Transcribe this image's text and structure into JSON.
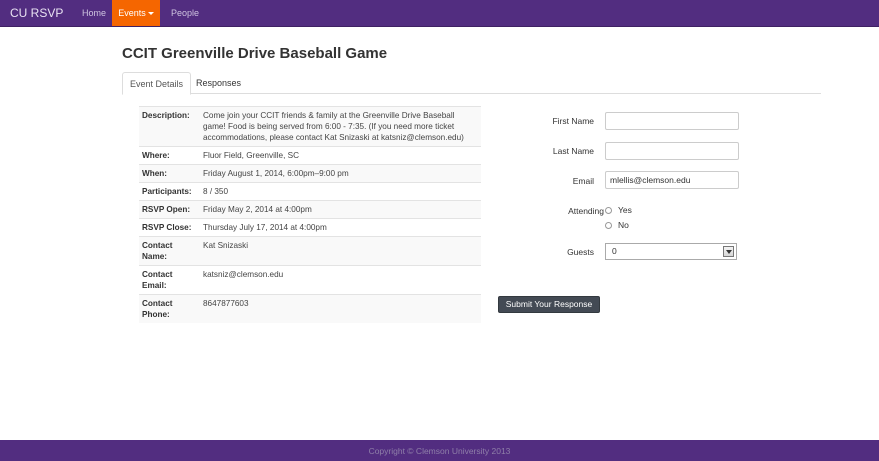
{
  "navbar": {
    "brand": "CU RSVP",
    "items": [
      {
        "label": "Home"
      },
      {
        "label": "Events"
      },
      {
        "label": "People"
      }
    ]
  },
  "page": {
    "title": "CCIT Greenville Drive Baseball Game"
  },
  "tabs": [
    {
      "label": "Event Details",
      "active": true
    },
    {
      "label": "Responses",
      "active": false
    }
  ],
  "details": [
    {
      "key": "Description:",
      "value": "Come join your CCIT friends & family at the Greenville Drive Baseball game! Food is being served from 6:00 - 7:35. (If you need more ticket accommodations, please contact Kat Snizaski at katsniz@clemson.edu)"
    },
    {
      "key": "Where:",
      "value": "Fluor Field, Greenville, SC"
    },
    {
      "key": "When:",
      "value": "Friday August 1, 2014, 6:00pm–9:00 pm"
    },
    {
      "key": "Participants:",
      "value": "8 / 350"
    },
    {
      "key": "RSVP Open:",
      "value": "Friday May 2, 2014 at 4:00pm"
    },
    {
      "key": "RSVP Close:",
      "value": "Thursday July 17, 2014 at 4:00pm"
    },
    {
      "key": "Contact Name:",
      "value": "Kat Snizaski"
    },
    {
      "key": "Contact Email:",
      "value": "katsniz@clemson.edu"
    },
    {
      "key": "Contact Phone:",
      "value": "8647877603"
    }
  ],
  "form": {
    "first_name": {
      "label": "First Name",
      "value": ""
    },
    "last_name": {
      "label": "Last Name",
      "value": ""
    },
    "email": {
      "label": "Email",
      "value": "mlellis@clemson.edu"
    },
    "attending": {
      "label": "Attending",
      "options": [
        "Yes",
        "No"
      ]
    },
    "guests": {
      "label": "Guests",
      "value": "0"
    },
    "submit_label": "Submit Your Response"
  },
  "footer": {
    "text": "Copyright © Clemson University 2013"
  },
  "colors": {
    "navbar": "#522d80",
    "active_nav": "#f56600",
    "submit": "#434a54"
  }
}
